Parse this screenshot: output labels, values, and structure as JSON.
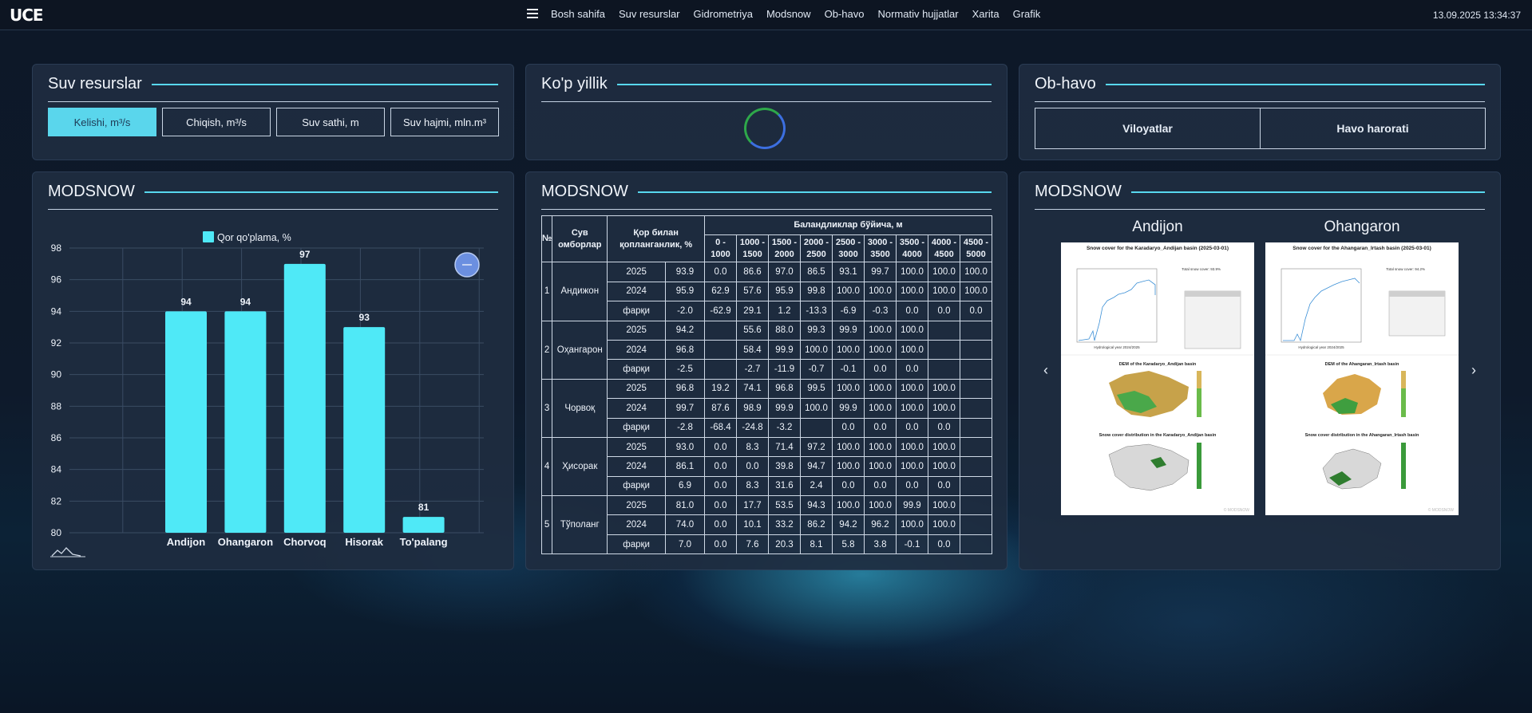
{
  "header": {
    "logo": "UCE",
    "nav": [
      "Bosh sahifa",
      "Suv resurslar",
      "Gidrometriya",
      "Modsnow",
      "Ob-havo",
      "Normativ hujjatlar",
      "Xarita",
      "Grafik"
    ],
    "datetime": "13.09.2025 13:34:37"
  },
  "suv_resurslar": {
    "title": "Suv resurslar",
    "tabs": [
      "Kelishi, m³/s",
      "Chiqish, m³/s",
      "Suv sathi, m",
      "Suv hajmi, mln.m³"
    ],
    "active_tab": 0
  },
  "kop_yillik": {
    "title": "Ko'p yillik"
  },
  "ob_havo": {
    "title": "Ob-havo",
    "buttons": [
      "Viloyatlar",
      "Havo harorati"
    ]
  },
  "modsnow_chart": {
    "title": "MODSNOW",
    "colors": {
      "bar": "#4fe9f7",
      "grid": "#3a4c63"
    },
    "chart_data": {
      "type": "bar",
      "categories": [
        "Andijon",
        "Ohangaron",
        "Chorvoq",
        "Hisorak",
        "To'palang"
      ],
      "series": [
        {
          "name": "Qor qo'plama, %",
          "values": [
            94,
            94,
            97,
            93,
            81
          ]
        }
      ],
      "ylim": [
        80,
        98
      ],
      "yticks": [
        80,
        82,
        84,
        86,
        88,
        90,
        92,
        94,
        96,
        98
      ],
      "legend": "top-center",
      "grid": true
    }
  },
  "modsnow_table": {
    "title": "MODSNOW",
    "headers": {
      "no": "№",
      "name": "Сув омборлар",
      "cover": "Қор билан қопланганлик, %",
      "heights_group": "Баландликлар бўйича, м",
      "bands": [
        "0 - 1000",
        "1000 - 1500",
        "1500 - 2000",
        "2000 - 2500",
        "2500 - 3000",
        "3000 - 3500",
        "3500 - 4000",
        "4000 - 4500",
        "4500 - 5000"
      ]
    },
    "groups": [
      {
        "no": "1",
        "name": "Андижон",
        "rows": [
          [
            "2025",
            "93.9",
            "0.0",
            "86.6",
            "97.0",
            "86.5",
            "93.1",
            "99.7",
            "100.0",
            "100.0",
            "100.0"
          ],
          [
            "2024",
            "95.9",
            "62.9",
            "57.6",
            "95.9",
            "99.8",
            "100.0",
            "100.0",
            "100.0",
            "100.0",
            "100.0"
          ],
          [
            "фарқи",
            "-2.0",
            "-62.9",
            "29.1",
            "1.2",
            "-13.3",
            "-6.9",
            "-0.3",
            "0.0",
            "0.0",
            "0.0"
          ]
        ]
      },
      {
        "no": "2",
        "name": "Оҳангарон",
        "rows": [
          [
            "2025",
            "94.2",
            "",
            "55.6",
            "88.0",
            "99.3",
            "99.9",
            "100.0",
            "100.0",
            "",
            ""
          ],
          [
            "2024",
            "96.8",
            "",
            "58.4",
            "99.9",
            "100.0",
            "100.0",
            "100.0",
            "100.0",
            "",
            ""
          ],
          [
            "фарқи",
            "-2.5",
            "",
            "-2.7",
            "-11.9",
            "-0.7",
            "-0.1",
            "0.0",
            "0.0",
            "",
            ""
          ]
        ]
      },
      {
        "no": "3",
        "name": "Чорвоқ",
        "rows": [
          [
            "2025",
            "96.8",
            "19.2",
            "74.1",
            "96.8",
            "99.5",
            "100.0",
            "100.0",
            "100.0",
            "100.0",
            ""
          ],
          [
            "2024",
            "99.7",
            "87.6",
            "98.9",
            "99.9",
            "100.0",
            "99.9",
            "100.0",
            "100.0",
            "100.0",
            ""
          ],
          [
            "фарқи",
            "-2.8",
            "-68.4",
            "-24.8",
            "-3.2",
            "",
            "0.0",
            "0.0",
            "0.0",
            "0.0",
            ""
          ]
        ]
      },
      {
        "no": "4",
        "name": "Ҳисорак",
        "rows": [
          [
            "2025",
            "93.0",
            "0.0",
            "8.3",
            "71.4",
            "97.2",
            "100.0",
            "100.0",
            "100.0",
            "100.0",
            ""
          ],
          [
            "2024",
            "86.1",
            "0.0",
            "0.0",
            "39.8",
            "94.7",
            "100.0",
            "100.0",
            "100.0",
            "100.0",
            ""
          ],
          [
            "фарқи",
            "6.9",
            "0.0",
            "8.3",
            "31.6",
            "2.4",
            "0.0",
            "0.0",
            "0.0",
            "0.0",
            ""
          ]
        ]
      },
      {
        "no": "5",
        "name": "Тўполанг",
        "rows": [
          [
            "2025",
            "81.0",
            "0.0",
            "17.7",
            "53.5",
            "94.3",
            "100.0",
            "100.0",
            "99.9",
            "100.0",
            ""
          ],
          [
            "2024",
            "74.0",
            "0.0",
            "10.1",
            "33.2",
            "86.2",
            "94.2",
            "96.2",
            "100.0",
            "100.0",
            ""
          ],
          [
            "фарқи",
            "7.0",
            "0.0",
            "7.6",
            "20.3",
            "8.1",
            "5.8",
            "3.8",
            "-0.1",
            "0.0",
            ""
          ]
        ]
      }
    ]
  },
  "modsnow_carousel": {
    "title": "MODSNOW",
    "prev_icon": "chevron-left-icon",
    "next_icon": "chevron-right-icon",
    "cards": [
      {
        "name": "Andijon",
        "img_title": "Snow cover for the Karadaryo_Andijan basin (2025-03-01)",
        "dem_title": "DEM of the Karadaryo_Andijan basin",
        "dist_title": "Snow cover distribution in the Karadaryo_Andijan basin",
        "total": "Total snow cover: 93.9%",
        "xlabel": "Hydrological year 2024/2025",
        "watermark": "© MODSNOW"
      },
      {
        "name": "Ohangaron",
        "img_title": "Snow cover for the Ahangaran_Irtash basin (2025-03-01)",
        "dem_title": "DEM of the Ahangaran_Irtash basin",
        "dist_title": "Snow cover distribution in the Ahangaran_Irtash basin",
        "total": "Total snow cover: 94.2%",
        "xlabel": "Hydrological year 2024/2025",
        "watermark": "© MODSNOW"
      }
    ]
  }
}
